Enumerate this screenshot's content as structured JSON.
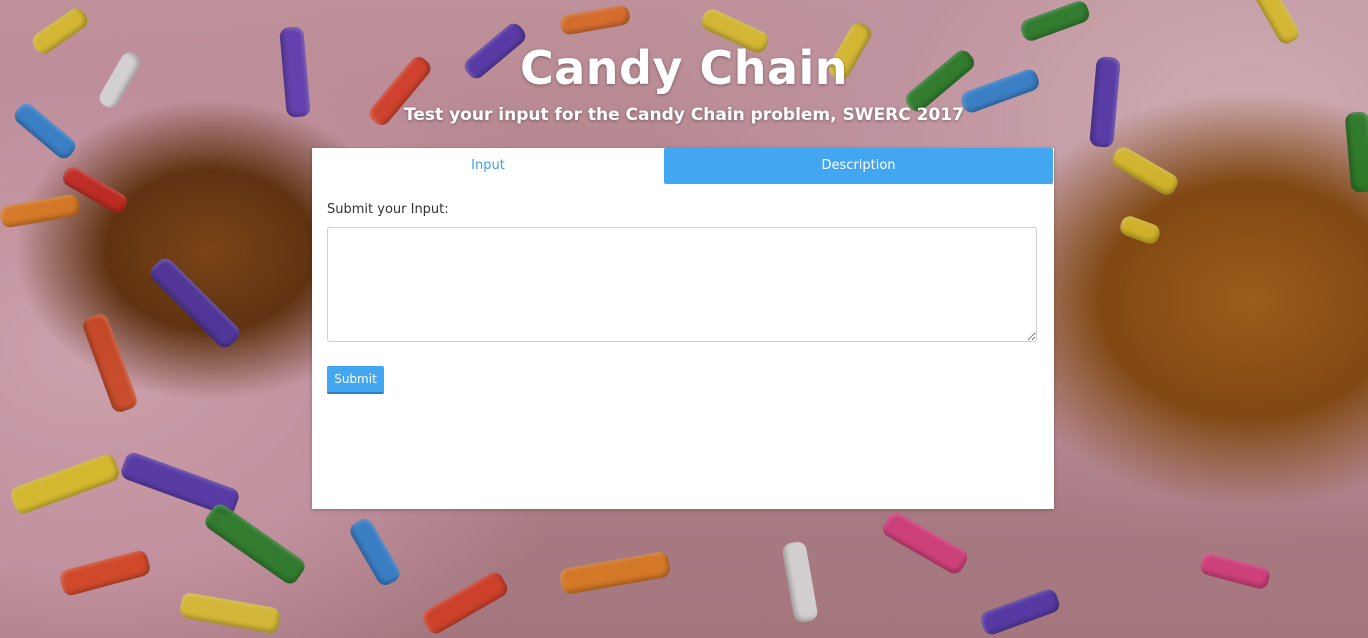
{
  "header": {
    "title": "Candy Chain",
    "subtitle": "Test your input for the Candy Chain problem, SWERC 2017"
  },
  "tabs": [
    {
      "label": "Input",
      "active": true
    },
    {
      "label": "Description",
      "active": false
    }
  ],
  "form": {
    "label": "Submit your Input:",
    "input_value": "",
    "submit_label": "Submit"
  },
  "colors": {
    "accent": "#42a6f0",
    "active_tab_text": "#3ea0e6",
    "card_background": "#ffffff"
  }
}
